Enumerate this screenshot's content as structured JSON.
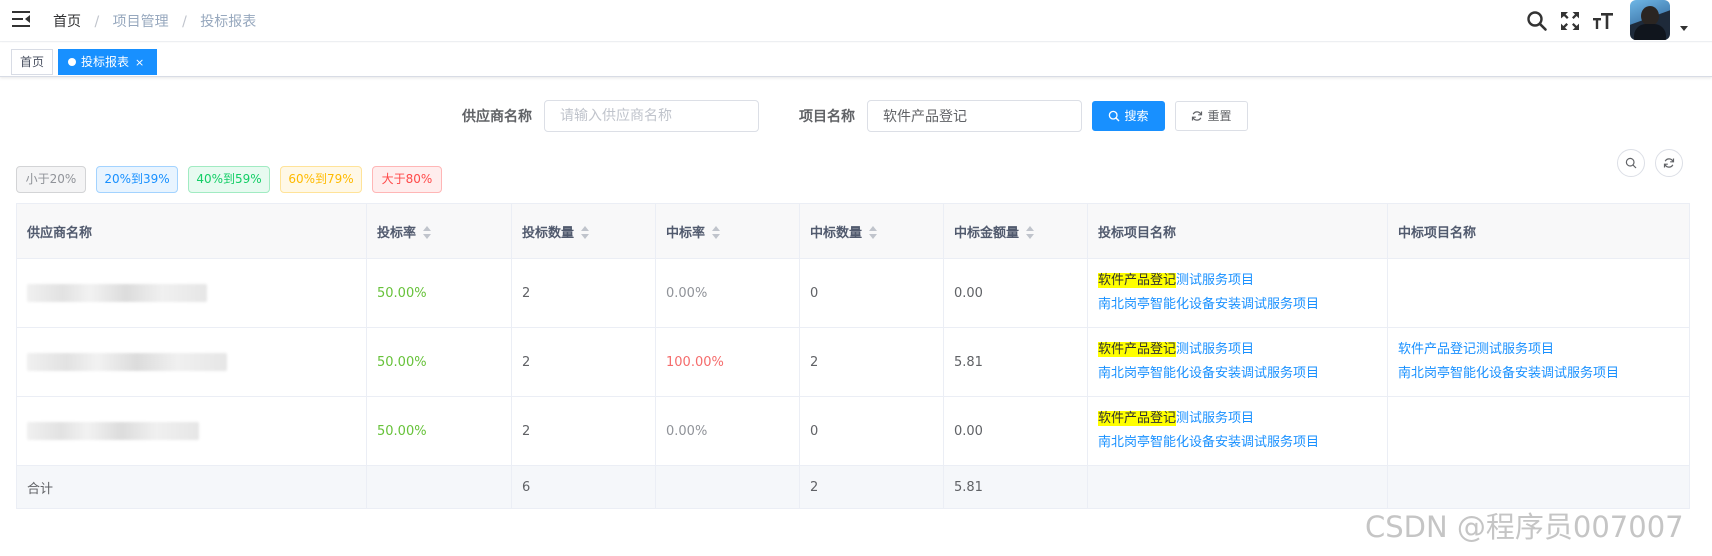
{
  "navbar": {
    "breadcrumb": [
      "首页",
      "项目管理",
      "投标报表"
    ],
    "icons": [
      "search-icon",
      "fullscreen-icon",
      "font-size-icon"
    ]
  },
  "tags": {
    "home": "首页",
    "active": "投标报表",
    "close": "×"
  },
  "search": {
    "supplier_label": "供应商名称",
    "supplier_placeholder": "请输入供应商名称",
    "supplier_value": "",
    "project_label": "项目名称",
    "project_value": "软件产品登记",
    "search_btn": "搜索",
    "reset_btn": "重置"
  },
  "filters": [
    {
      "label": "小于20%",
      "color": "#909399",
      "bg": "#f4f4f5",
      "border": "#d3d4d6"
    },
    {
      "label": "20%到39%",
      "color": "#1890ff",
      "bg": "#e8f4ff",
      "border": "#a3d3ff"
    },
    {
      "label": "40%到59%",
      "color": "#13ce66",
      "bg": "#e7faf0",
      "border": "#a1ebc2"
    },
    {
      "label": "60%到79%",
      "color": "#ffba00",
      "bg": "#fff8e6",
      "border": "#ffe399"
    },
    {
      "label": "大于80%",
      "color": "#ff4949",
      "bg": "#ffeded",
      "border": "#ffb6b6"
    }
  ],
  "table": {
    "headers": [
      "供应商名称",
      "投标率",
      "投标数量",
      "中标率",
      "中标数量",
      "中标金额量",
      "投标项目名称",
      "中标项目名称"
    ],
    "rows": [
      {
        "supplier": "",
        "bid_rate": "50.00%",
        "bid_count": "2",
        "win_rate": "0.00%",
        "win_count": "0",
        "win_amount": "0.00",
        "bid_projects": [
          {
            "highlight": "软件产品登记",
            "rest": "测试服务项目"
          },
          {
            "highlight": "",
            "rest": "南北岗亭智能化设备安装调试服务项目"
          }
        ],
        "win_projects": []
      },
      {
        "supplier": "",
        "bid_rate": "50.00%",
        "bid_count": "2",
        "win_rate": "100.00%",
        "win_count": "2",
        "win_amount": "5.81",
        "bid_projects": [
          {
            "highlight": "软件产品登记",
            "rest": "测试服务项目"
          },
          {
            "highlight": "",
            "rest": "南北岗亭智能化设备安装调试服务项目"
          }
        ],
        "win_projects": [
          "软件产品登记测试服务项目",
          "南北岗亭智能化设备安装调试服务项目"
        ]
      },
      {
        "supplier": "",
        "bid_rate": "50.00%",
        "bid_count": "2",
        "win_rate": "0.00%",
        "win_count": "0",
        "win_amount": "0.00",
        "bid_projects": [
          {
            "highlight": "软件产品登记",
            "rest": "测试服务项目"
          },
          {
            "highlight": "",
            "rest": "南北岗亭智能化设备安装调试服务项目"
          }
        ],
        "win_projects": []
      }
    ],
    "summary": {
      "label": "合计",
      "bid_count": "6",
      "win_count": "2",
      "win_amount": "5.81"
    }
  },
  "watermark": "CSDN @程序员007007",
  "colors": {
    "primary": "#1890ff",
    "success": "#67c23a",
    "danger": "#f56c6c",
    "highlight": "#ffff00"
  }
}
